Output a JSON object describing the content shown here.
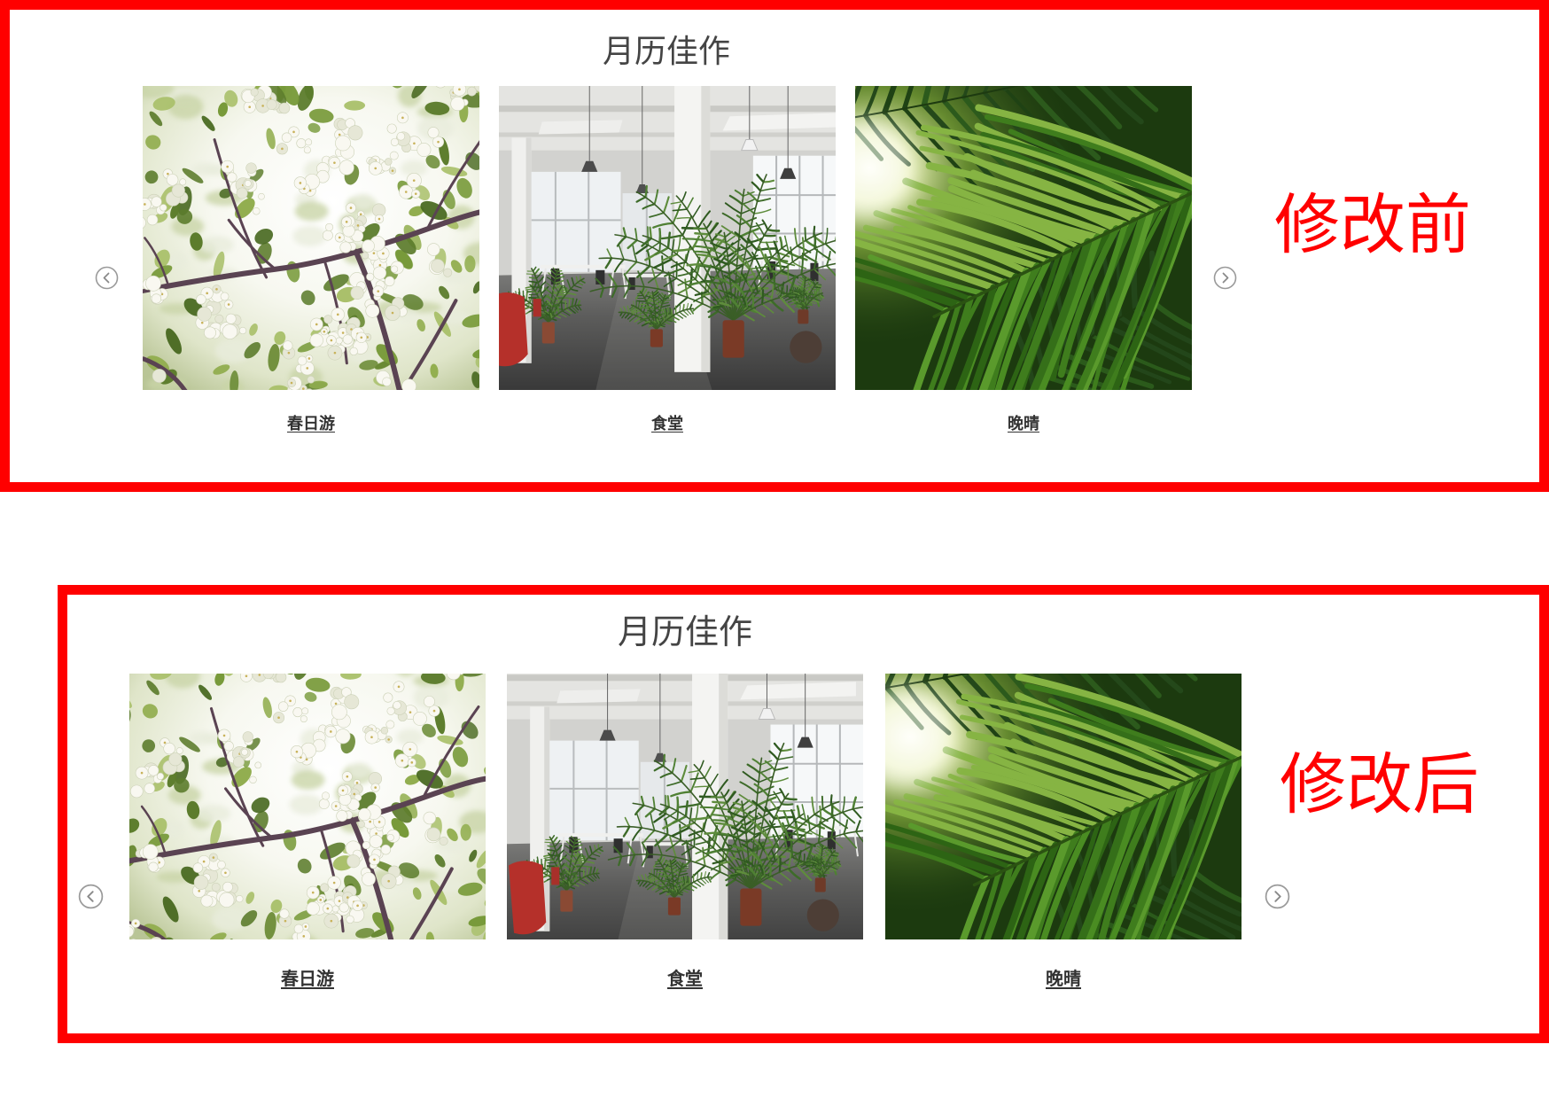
{
  "panels": [
    {
      "title": "月历佳作",
      "label": "修改前",
      "items": [
        {
          "caption": "春日游"
        },
        {
          "caption": "食堂"
        },
        {
          "caption": "晚晴"
        }
      ]
    },
    {
      "title": "月历佳作",
      "label": "修改后",
      "items": [
        {
          "caption": "春日游"
        },
        {
          "caption": "食堂"
        },
        {
          "caption": "晚晴"
        }
      ]
    }
  ],
  "icons": {
    "prev": "chevron-left-circle-icon",
    "next": "chevron-right-circle-icon"
  },
  "colors": {
    "annotation": "#ff0000",
    "frame": "#ff0000",
    "title": "#444444",
    "caption": "#333333",
    "arrow": "#9a9a9a"
  }
}
